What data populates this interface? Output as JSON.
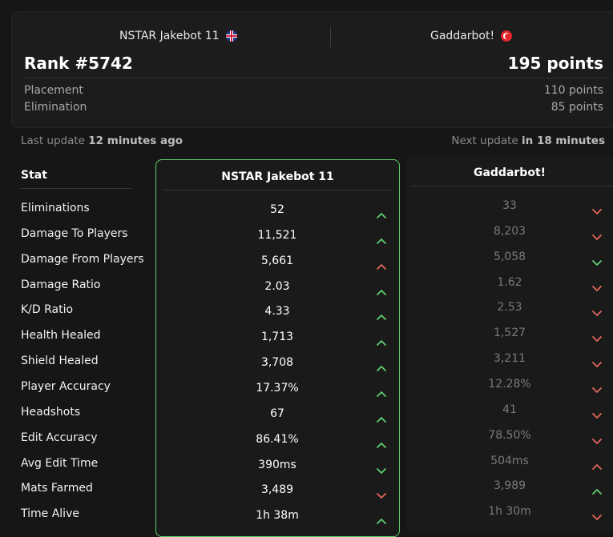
{
  "header": {
    "player1": {
      "name": "NSTAR Jakebot 11",
      "flag": "uk-flag-icon"
    },
    "player2": {
      "name": "Gaddarbot!",
      "flag": "turkey-flag-icon"
    },
    "rank": "Rank #5742",
    "points": "195 points",
    "rows": [
      {
        "label": "Placement",
        "value": "110 points"
      },
      {
        "label": "Elimination",
        "value": "85 points"
      }
    ]
  },
  "update": {
    "last_prefix": "Last update ",
    "last_value": "12 minutes ago",
    "next_prefix": "Next update ",
    "next_value": "in 18 minutes"
  },
  "table": {
    "stat_header": "Stat",
    "col_main_title": "NSTAR Jakebot 11",
    "col_opp_title": "Gaddarbot!",
    "rows": [
      {
        "label": "Eliminations",
        "main": "52",
        "main_dir": "up",
        "opp": "33",
        "opp_dir": "down"
      },
      {
        "label": "Damage To Players",
        "main": "11,521",
        "main_dir": "up",
        "opp": "8,203",
        "opp_dir": "down"
      },
      {
        "label": "Damage From Players",
        "main": "5,661",
        "main_dir": "up-red",
        "opp": "5,058",
        "opp_dir": "down-green"
      },
      {
        "label": "Damage Ratio",
        "main": "2.03",
        "main_dir": "up",
        "opp": "1.62",
        "opp_dir": "down"
      },
      {
        "label": "K/D Ratio",
        "main": "4.33",
        "main_dir": "up",
        "opp": "2.53",
        "opp_dir": "down"
      },
      {
        "label": "Health Healed",
        "main": "1,713",
        "main_dir": "up",
        "opp": "1,527",
        "opp_dir": "down"
      },
      {
        "label": "Shield Healed",
        "main": "3,708",
        "main_dir": "up",
        "opp": "3,211",
        "opp_dir": "down"
      },
      {
        "label": "Player Accuracy",
        "main": "17.37%",
        "main_dir": "up",
        "opp": "12.28%",
        "opp_dir": "down"
      },
      {
        "label": "Headshots",
        "main": "67",
        "main_dir": "up",
        "opp": "41",
        "opp_dir": "down"
      },
      {
        "label": "Edit Accuracy",
        "main": "86.41%",
        "main_dir": "up",
        "opp": "78.50%",
        "opp_dir": "down"
      },
      {
        "label": "Avg Edit Time",
        "main": "390ms",
        "main_dir": "down-green",
        "opp": "504ms",
        "opp_dir": "up-red"
      },
      {
        "label": "Mats Farmed",
        "main": "3,489",
        "main_dir": "down",
        "opp": "3,989",
        "opp_dir": "up"
      },
      {
        "label": "Time Alive",
        "main": "1h 38m",
        "main_dir": "up",
        "opp": "1h 30m",
        "opp_dir": "down"
      }
    ]
  },
  "colors": {
    "green": "#5fcf6f",
    "red": "#e0685c",
    "accent_border": "#5fcf6f"
  }
}
